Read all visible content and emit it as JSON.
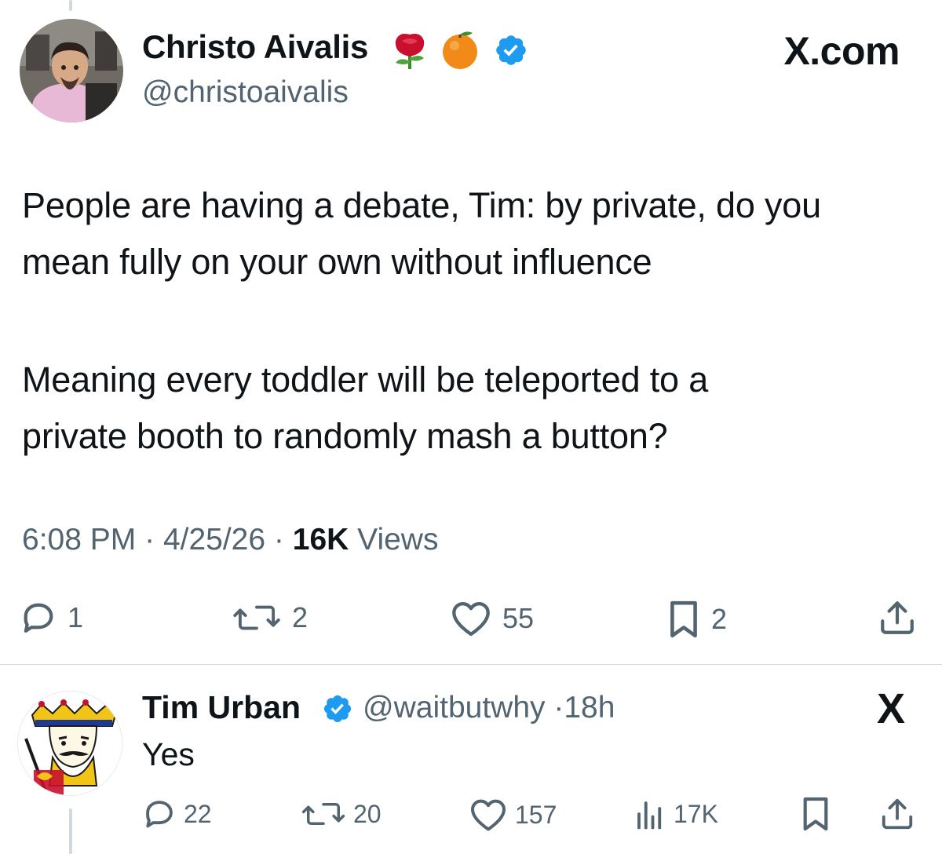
{
  "tweet": {
    "author_name": "Christo Aivalis",
    "author_handle": "@christoaivalis",
    "author_emojis": [
      "rose-emoji",
      "orange-emoji"
    ],
    "verified_badge": "verified-icon",
    "brand": "X.com",
    "text_paragraph_1": [
      "People are having a debate, Tim: by private, do you",
      "mean fully on your own without influence"
    ],
    "text_paragraph_2": [
      "Meaning every toddler will be teleported to a",
      "private booth to randomly mash a button?"
    ],
    "time": "6:08 PM",
    "date": "4/25/26",
    "separator": "·",
    "views_count": "16K",
    "views_label": "Views",
    "actions": {
      "replies": "1",
      "reposts": "2",
      "likes": "55",
      "bookmarks": "2"
    }
  },
  "reply": {
    "author_name": "Tim Urban",
    "author_handle": "@waitbutwhy",
    "time_ago": "18h",
    "separator": "·",
    "text": "Yes",
    "close_glyph": "X",
    "actions": {
      "replies": "22",
      "reposts": "20",
      "likes": "157",
      "views": "17K"
    }
  },
  "colors": {
    "text_primary": "#0f1419",
    "text_secondary": "#536471",
    "verified_blue": "#1d9bf0",
    "divider": "#cfd9de"
  }
}
